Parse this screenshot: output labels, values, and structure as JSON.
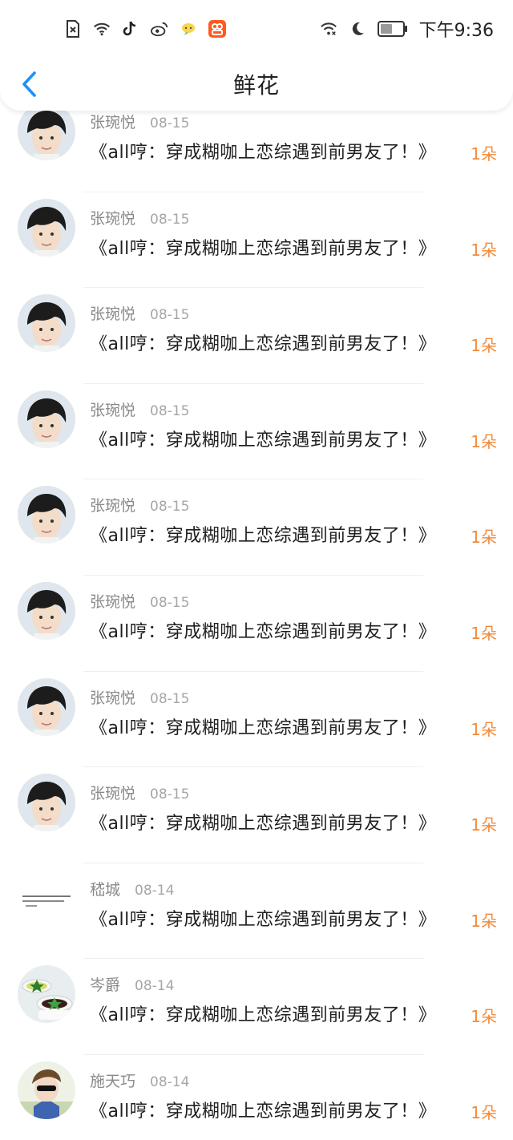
{
  "status_bar": {
    "time": "下午9:36",
    "left_icons": [
      "sim-off-icon",
      "wifi-icon",
      "tiktok-icon",
      "weibo-icon",
      "chat-bubble-icon",
      "app-icon"
    ],
    "right_icons": [
      "wifi-signal-icon",
      "moon-icon",
      "battery-icon"
    ]
  },
  "header": {
    "title": "鲜花",
    "back_icon": "chevron-left-icon",
    "accent_color": "#1e90ff"
  },
  "list": {
    "items": [
      {
        "name": "张琬悦",
        "date": "08-15",
        "book": "《all哼：穿成糊咖上恋综遇到前男友了！》",
        "count": "1朵",
        "avatar": "boy"
      },
      {
        "name": "张琬悦",
        "date": "08-15",
        "book": "《all哼：穿成糊咖上恋综遇到前男友了！》",
        "count": "1朵",
        "avatar": "boy"
      },
      {
        "name": "张琬悦",
        "date": "08-15",
        "book": "《all哼：穿成糊咖上恋综遇到前男友了！》",
        "count": "1朵",
        "avatar": "boy"
      },
      {
        "name": "张琬悦",
        "date": "08-15",
        "book": "《all哼：穿成糊咖上恋综遇到前男友了！》",
        "count": "1朵",
        "avatar": "boy"
      },
      {
        "name": "张琬悦",
        "date": "08-15",
        "book": "《all哼：穿成糊咖上恋综遇到前男友了！》",
        "count": "1朵",
        "avatar": "boy"
      },
      {
        "name": "张琬悦",
        "date": "08-15",
        "book": "《all哼：穿成糊咖上恋综遇到前男友了！》",
        "count": "1朵",
        "avatar": "boy"
      },
      {
        "name": "张琬悦",
        "date": "08-15",
        "book": "《all哼：穿成糊咖上恋综遇到前男友了！》",
        "count": "1朵",
        "avatar": "boy"
      },
      {
        "name": "张琬悦",
        "date": "08-15",
        "book": "《all哼：穿成糊咖上恋综遇到前男友了！》",
        "count": "1朵",
        "avatar": "boy"
      },
      {
        "name": "嵇城",
        "date": "08-14",
        "book": "《all哼：穿成糊咖上恋综遇到前男友了！》",
        "count": "1朵",
        "avatar": "text"
      },
      {
        "name": "岑爵",
        "date": "08-14",
        "book": "《all哼：穿成糊咖上恋综遇到前男友了！》",
        "count": "1朵",
        "avatar": "dessert"
      },
      {
        "name": "施天巧",
        "date": "08-14",
        "book": "《all哼：穿成糊咖上恋综遇到前男友了！》",
        "count": "1朵",
        "avatar": "kid"
      }
    ]
  },
  "colors": {
    "count": "#f28a3a",
    "name": "#8a8a8a",
    "date": "#a6a6a6"
  }
}
